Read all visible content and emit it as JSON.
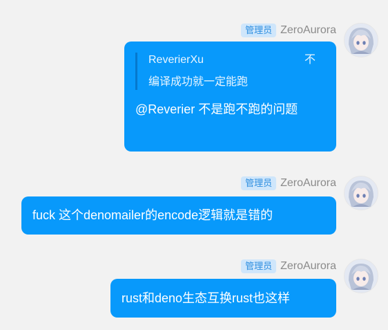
{
  "messages": [
    {
      "sender": {
        "role_badge": "管理员",
        "name": "ZeroAurora",
        "avatar_icon": "anime-avatar"
      },
      "reply_to": {
        "author": "ReverierXu",
        "preview_tail": "不",
        "text": "编译成功就一定能跑"
      },
      "text": "@Reverier 不是跑不跑的问题"
    },
    {
      "sender": {
        "role_badge": "管理员",
        "name": "ZeroAurora",
        "avatar_icon": "anime-avatar"
      },
      "text": "fuck 这个denomailer的encode逻辑就是错的"
    },
    {
      "sender": {
        "role_badge": "管理员",
        "name": "ZeroAurora",
        "avatar_icon": "anime-avatar"
      },
      "text": "rust和deno生态互换rust也这样"
    }
  ],
  "colors": {
    "background": "#f2f2f2",
    "bubble": "#0899fb",
    "badge_bg": "#cfe6fb",
    "badge_text": "#2f8fe0",
    "sender_name": "#8a8a8a"
  }
}
